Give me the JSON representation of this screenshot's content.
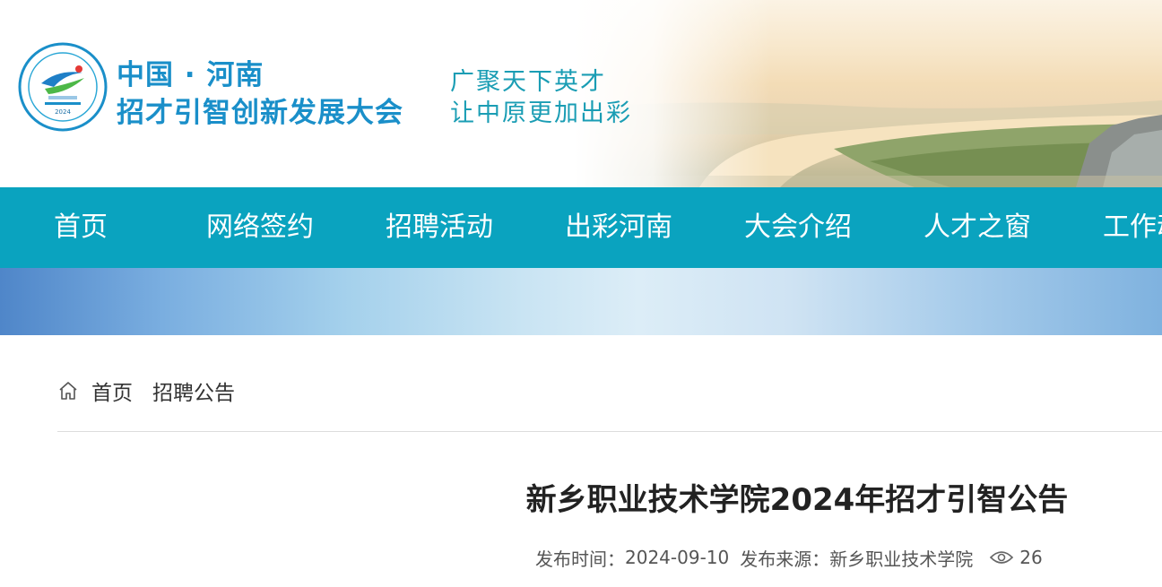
{
  "header": {
    "logo_line1": "中国 · 河南",
    "logo_line2": "招才引智创新发展大会",
    "slogan_line1": "广聚天下英才",
    "slogan_line2": "让中原更加出彩",
    "emblem_year": "2024",
    "emblem_small_text": "中国·河南"
  },
  "nav": {
    "items": [
      {
        "label": "首页"
      },
      {
        "label": "网络签约"
      },
      {
        "label": "招聘活动"
      },
      {
        "label": "出彩河南"
      },
      {
        "label": "大会介绍"
      },
      {
        "label": "人才之窗"
      },
      {
        "label": "工作动态"
      }
    ]
  },
  "breadcrumb": {
    "home": "首页",
    "current": "招聘公告"
  },
  "article": {
    "title": "新乡职业技术学院2024年招才引智公告",
    "publish_time_label": "发布时间：",
    "publish_time": "2024-09-10",
    "source_label": "发布来源：",
    "source": "新乡职业技术学院",
    "views": "26"
  },
  "colors": {
    "nav_bg": "#0aa3bf",
    "logo_blue": "#1a8fc9",
    "slogan_teal": "#1a9db4"
  },
  "icons": [
    "home-icon",
    "eye-icon",
    "logo-emblem"
  ]
}
